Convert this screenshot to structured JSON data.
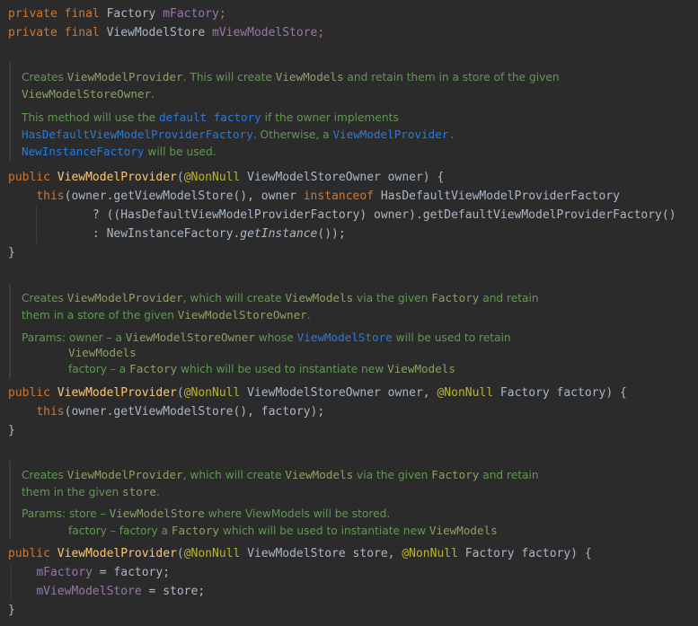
{
  "code": {
    "field1": {
      "mod": "private final",
      "type": "Factory",
      "name": "mFactory",
      "end": ";"
    },
    "field2": {
      "mod": "private final",
      "type": "ViewModelStore",
      "name": "mViewModelStore",
      "end": ";"
    },
    "doc1": {
      "l1a": "Creates ",
      "l1b": "ViewModelProvider",
      "l1c": ". This will create ",
      "l1d": "ViewModels",
      "l1e": " and retain them in a store of the given",
      "l2a": "ViewModelStoreOwner",
      "l2b": ".",
      "l3a": "This method will use the ",
      "l3b": "default factory",
      "l3c": " if the owner implements",
      "l4a": "HasDefaultViewModelProviderFactory",
      "l4b": ". Otherwise, a ",
      "l4c": "ViewModelProvider.",
      "l5a": "NewInstanceFactory",
      "l5b": " will be used."
    },
    "ctor1": {
      "pub": "public",
      "name": "ViewModelProvider",
      "open": "(",
      "ann": "@NonNull",
      "params": " ViewModelStoreOwner owner) {",
      "b1a": "    ",
      "b1b": "this",
      "b1c": "(owner.getViewModelStore(), owner ",
      "b1d": "instanceof",
      "b1e": " HasDefaultViewModelProviderFactory",
      "b2": "            ? ((HasDefaultViewModelProviderFactory) owner).getDefaultViewModelProviderFactory()",
      "b3a": "            : NewInstanceFactory.",
      "b3b": "getInstance",
      "b3c": "());",
      "close": "}"
    },
    "doc2": {
      "l1a": "Creates ",
      "l1b": "ViewModelProvider",
      "l1c": ", which will create ",
      "l1d": "ViewModels",
      "l1e": " via the given ",
      "l1f": "Factory",
      "l1g": " and retain",
      "l2a": "them in a store of the given ",
      "l2b": "ViewModelStoreOwner",
      "l2c": ".",
      "l3a": "Params: owner – a ",
      "l3b": "ViewModelStoreOwner",
      "l3c": " whose ",
      "l3d": "ViewModelStore",
      "l3e": " will be used to retain",
      "l4": "ViewModels",
      "l5a": "factory – a ",
      "l5b": "Factory",
      "l5c": " which will be used to instantiate new ",
      "l5d": "ViewModels"
    },
    "ctor2": {
      "pub": "public",
      "name": "ViewModelProvider",
      "open": "(",
      "ann1": "@NonNull",
      "mid": " ViewModelStoreOwner owner, ",
      "ann2": "@NonNull",
      "params": " Factory factory) {",
      "b1a": "    ",
      "b1b": "this",
      "b1c": "(owner.getViewModelStore(), factory);",
      "close": "}"
    },
    "doc3": {
      "l1a": "Creates ",
      "l1b": "ViewModelProvider",
      "l1c": ", which will create ",
      "l1d": "ViewModels",
      "l1e": " via the given ",
      "l1f": "Factory",
      "l1g": " and retain",
      "l2a": "them in the given ",
      "l2b": "store",
      "l2c": ".",
      "l3a": "Params: store – ",
      "l3b": "ViewModelStore",
      "l3c": " where ViewModels will be stored.",
      "l4a": "factory – factory a ",
      "l4b": "Factory",
      "l4c": " which will be used to instantiate new ",
      "l4d": "ViewModels"
    },
    "ctor3": {
      "pub": "public",
      "name": "ViewModelProvider",
      "open": "(",
      "ann1": "@NonNull",
      "mid": " ViewModelStore store, ",
      "ann2": "@NonNull",
      "params": " Factory factory) {",
      "b1a": "    ",
      "b1b": "mFactory",
      "b1c": " = factory;",
      "b2a": "    ",
      "b2b": "mViewModelStore",
      "b2c": " = store;",
      "close": "}"
    }
  }
}
